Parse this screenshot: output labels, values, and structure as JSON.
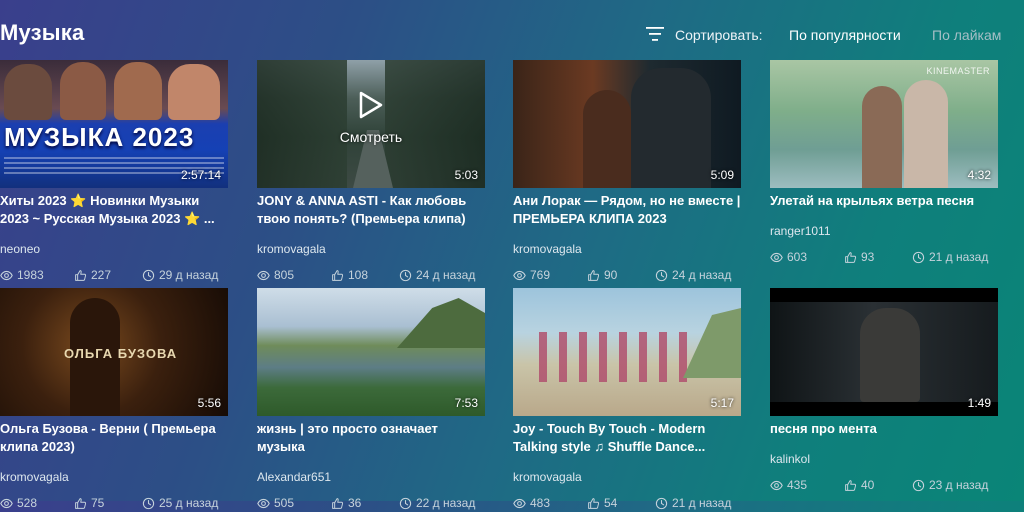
{
  "header": {
    "title": "Музыка",
    "sort_label": "Сортировать:",
    "sort_options": [
      "По популярности",
      "По лайкам"
    ],
    "active_sort": "По популярности"
  },
  "thumbnail_texts": {
    "watch": "Смотреть",
    "banner": "МУЗЫКА 2023",
    "olga": "ОЛЬГА БУЗОВА",
    "kinemaster": "KINEMASTER"
  },
  "colors": {
    "bg_start": "#3a3f8c",
    "bg_end": "#0a8577",
    "inactive_sort": "#a6bfc6"
  },
  "videos": [
    {
      "title": "Хиты 2023 ⭐ Новинки Музыки 2023 ~ Русская Музыка 2023 ⭐ ...",
      "duration": "2:57:14",
      "author": "neoneo",
      "views": "1983",
      "likes": "227",
      "date": "29 д назад"
    },
    {
      "title": "JONY & ANNA ASTI - Как любовь твою понять? (Премьера клипа)",
      "duration": "5:03",
      "author": "kromovagala",
      "views": "805",
      "likes": "108",
      "date": "24 д назад"
    },
    {
      "title": "Ани Лорак — Рядом, но не вместе | ПРЕМЬЕРА КЛИПА 2023",
      "duration": "5:09",
      "author": "kromovagala",
      "views": "769",
      "likes": "90",
      "date": "24 д назад"
    },
    {
      "title": "Улетай на крыльях ветра песня",
      "duration": "4:32",
      "author": "ranger1011",
      "views": "603",
      "likes": "93",
      "date": "21 д назад"
    },
    {
      "title": "Ольга Бузова - Верни ( Премьера клипа 2023)",
      "duration": "5:56",
      "author": "kromovagala",
      "views": "528",
      "likes": "75",
      "date": "25 д назад"
    },
    {
      "title": "жизнь | это просто означает музыка",
      "duration": "7:53",
      "author": "Alexandar651",
      "views": "505",
      "likes": "36",
      "date": "22 д назад"
    },
    {
      "title": "Joy - Touch By Touch - Modern Talking style ♫ Shuffle Dance...",
      "duration": "5:17",
      "author": "kromovagala",
      "views": "483",
      "likes": "54",
      "date": "21 д назад"
    },
    {
      "title": "песня про мента",
      "duration": "1:49",
      "author": "kalinkol",
      "views": "435",
      "likes": "40",
      "date": "23 д назад"
    }
  ]
}
